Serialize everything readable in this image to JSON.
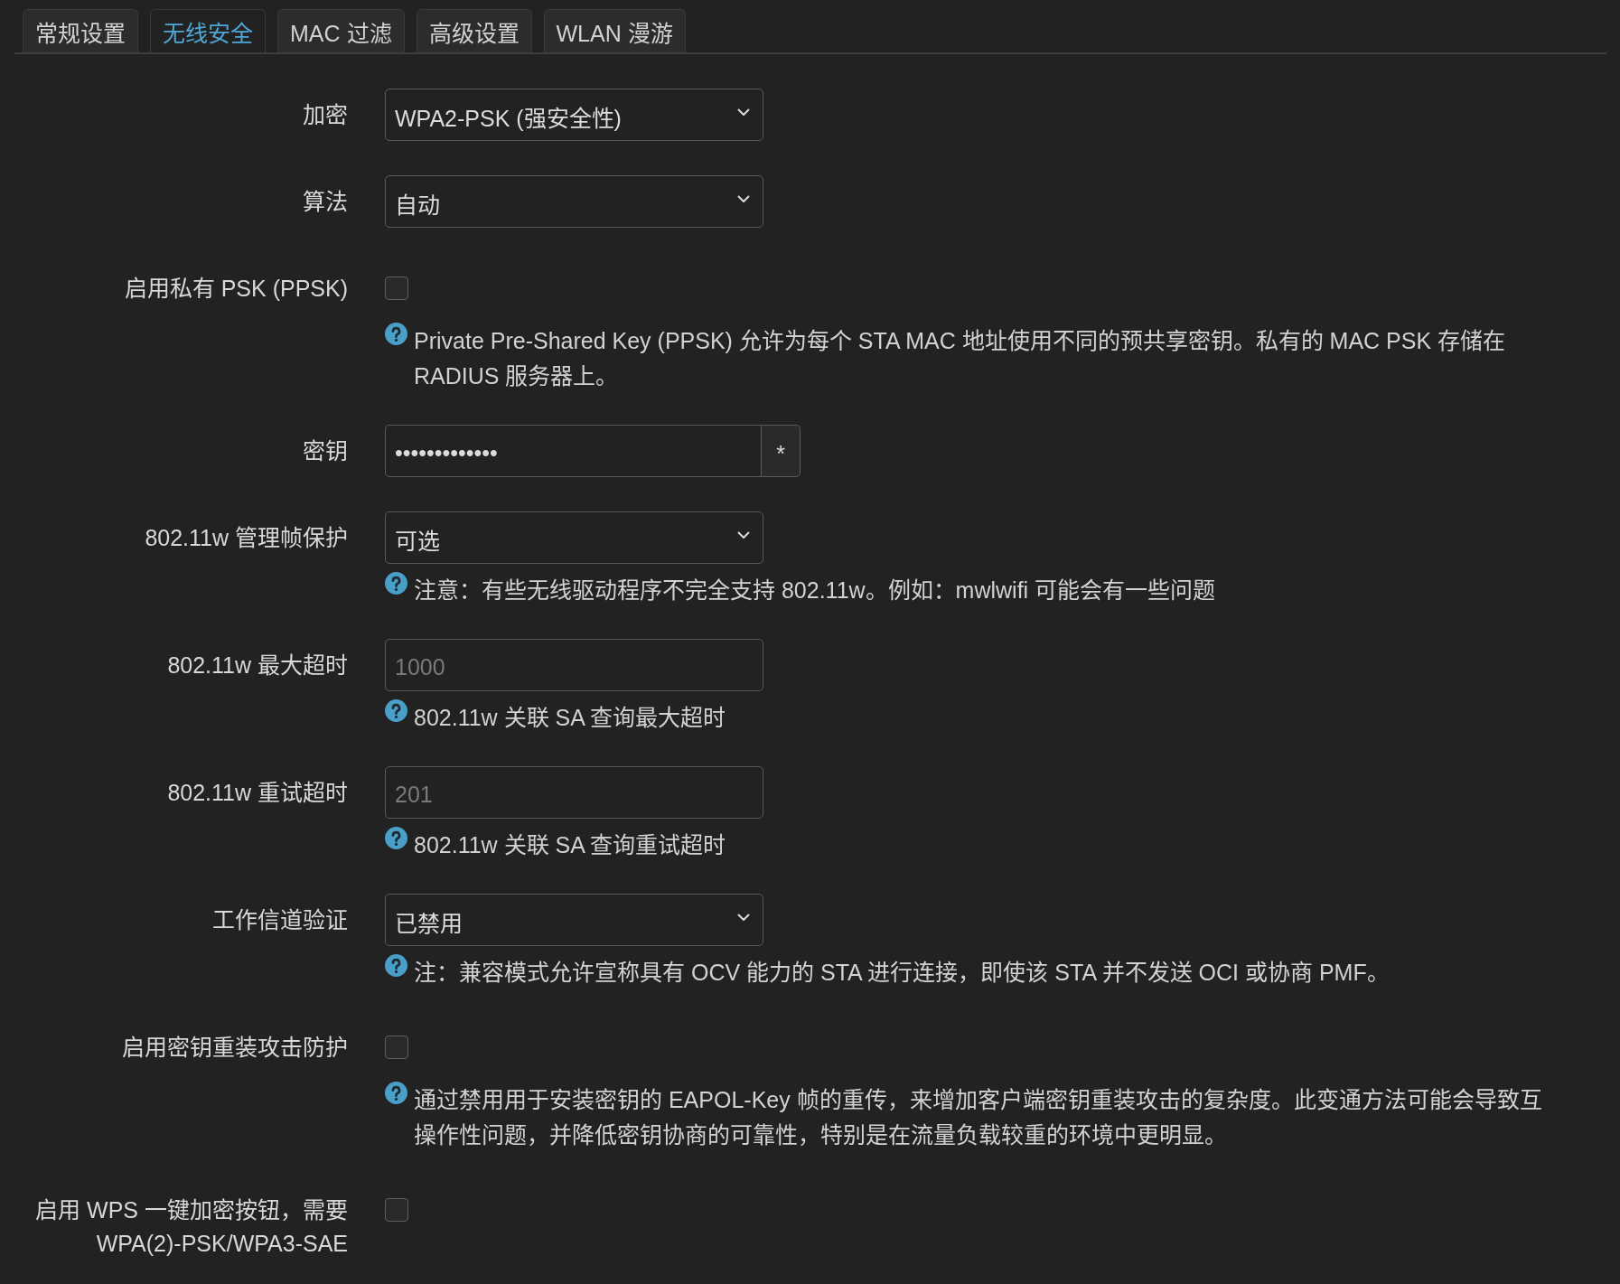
{
  "tabs": [
    {
      "label": "常规设置",
      "selected": false
    },
    {
      "label": "无线安全",
      "selected": true
    },
    {
      "label": "MAC 过滤",
      "selected": false
    },
    {
      "label": "高级设置",
      "selected": false
    },
    {
      "label": "WLAN 漫游",
      "selected": false
    }
  ],
  "fields": [
    {
      "kind": "select",
      "label": "加密",
      "value": "WPA2-PSK (强安全性)"
    },
    {
      "kind": "select",
      "label": "算法",
      "value": "自动"
    },
    {
      "kind": "checkbox",
      "label": "启用私有 PSK (PPSK)",
      "checked": false,
      "help": "Private Pre-Shared Key (PPSK) 允许为每个 STA MAC 地址使用不同的预共享密钥。私有的 MAC PSK 存储在 RADIUS 服务器上。"
    },
    {
      "kind": "password",
      "label": "密钥",
      "value": "•••••••••••••",
      "reveal_button": "*"
    },
    {
      "kind": "select",
      "label": "802.11w 管理帧保护",
      "value": "可选",
      "help": "注意：有些无线驱动程序不完全支持 802.11w。例如：mwlwifi 可能会有一些问题"
    },
    {
      "kind": "text",
      "label": "802.11w 最大超时",
      "placeholder": "1000",
      "help": "802.11w 关联 SA 查询最大超时"
    },
    {
      "kind": "text",
      "label": "802.11w 重试超时",
      "placeholder": "201",
      "help": "802.11w 关联 SA 查询重试超时"
    },
    {
      "kind": "select",
      "label": "工作信道验证",
      "value": "已禁用",
      "help": "注：兼容模式允许宣称具有 OCV 能力的 STA 进行连接，即使该 STA 并不发送 OCI 或协商 PMF。"
    },
    {
      "kind": "checkbox",
      "label": "启用密钥重装攻击防护",
      "checked": false,
      "help": "通过禁用用于安装密钥的 EAPOL-Key 帧的重传，来增加客户端密钥重装攻击的复杂度。此变通方法可能会导致互操作性问题，并降低密钥协商的可靠性，特别是在流量负载较重的环境中更明显。"
    },
    {
      "kind": "checkbox",
      "label": "启用 WPS 一键加密按钮，需要 WPA(2)-PSK/WPA3-SAE",
      "checked": false
    }
  ]
}
